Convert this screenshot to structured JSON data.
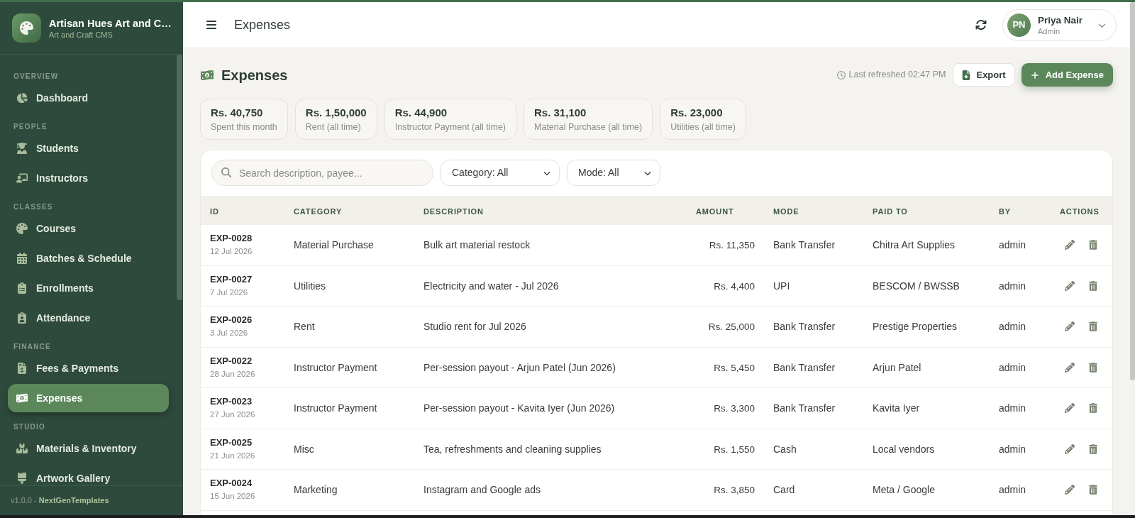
{
  "sidebar": {
    "brand": {
      "title": "Artisan Hues Art and C…",
      "subtitle": "Art and Craft CMS"
    },
    "sections": [
      {
        "heading": "OVERVIEW",
        "items": [
          {
            "label": "Dashboard",
            "selected": false
          }
        ]
      },
      {
        "heading": "PEOPLE",
        "items": [
          {
            "label": "Students",
            "selected": false
          },
          {
            "label": "Instructors",
            "selected": false
          }
        ]
      },
      {
        "heading": "CLASSES",
        "items": [
          {
            "label": "Courses",
            "selected": false
          },
          {
            "label": "Batches & Schedule",
            "selected": false
          },
          {
            "label": "Enrollments",
            "selected": false
          },
          {
            "label": "Attendance",
            "selected": false
          }
        ]
      },
      {
        "heading": "FINANCE",
        "items": [
          {
            "label": "Fees & Payments",
            "selected": false
          },
          {
            "label": "Expenses",
            "selected": true
          }
        ]
      },
      {
        "heading": "STUDIO",
        "items": [
          {
            "label": "Materials & Inventory",
            "selected": false
          },
          {
            "label": "Artwork Gallery",
            "selected": false
          }
        ]
      }
    ],
    "footer": "v1.0.0 - **NextGenTemplates**"
  },
  "header": {
    "title": "Expenses",
    "user": {
      "initials": "PN",
      "name": "Priya Nair",
      "role": "Admin"
    }
  },
  "page": {
    "title": "Expenses",
    "last_refreshed": "Last refreshed 02:47 PM",
    "actions": [
      {
        "label": "Export",
        "kind": "secondary"
      },
      {
        "label": "Add Expense",
        "kind": "primary"
      }
    ]
  },
  "stats": [
    {
      "value": "Rs. 40,750",
      "label": "Spent this month"
    },
    {
      "value": "Rs. 1,50,000",
      "label": "Rent (all time)"
    },
    {
      "value": "Rs. 44,900",
      "label": "Instructor Payment (all time)"
    },
    {
      "value": "Rs. 31,100",
      "label": "Material Purchase (all time)"
    },
    {
      "value": "Rs. 23,000",
      "label": "Utilities (all time)"
    }
  ],
  "filters": {
    "search": {
      "placeholder": "Search description, payee..."
    },
    "selects": [
      {
        "value": "Category: All"
      },
      {
        "value": "Mode: All"
      }
    ]
  },
  "table": {
    "columns": [
      "ID",
      "CATEGORY",
      "DESCRIPTION",
      "AMOUNT",
      "MODE",
      "PAID TO",
      "BY",
      "ACTIONS"
    ],
    "rows": [
      {
        "id": "EXP-0028",
        "date": "12 Jul 2026",
        "category": "Material Purchase",
        "description": "Bulk art material restock",
        "amount": "Rs. 11,350",
        "mode": "Bank Transfer",
        "paid_to": "Chitra Art Supplies",
        "by": "admin"
      },
      {
        "id": "EXP-0027",
        "date": "7 Jul 2026",
        "category": "Utilities",
        "description": "Electricity and water - Jul 2026",
        "amount": "Rs. 4,400",
        "mode": "UPI",
        "paid_to": "BESCOM / BWSSB",
        "by": "admin"
      },
      {
        "id": "EXP-0026",
        "date": "3 Jul 2026",
        "category": "Rent",
        "description": "Studio rent for Jul 2026",
        "amount": "Rs. 25,000",
        "mode": "Bank Transfer",
        "paid_to": "Prestige Properties",
        "by": "admin"
      },
      {
        "id": "EXP-0022",
        "date": "28 Jun 2026",
        "category": "Instructor Payment",
        "description": "Per-session payout - Arjun Patel (Jun 2026)",
        "amount": "Rs. 5,450",
        "mode": "Bank Transfer",
        "paid_to": "Arjun Patel",
        "by": "admin"
      },
      {
        "id": "EXP-0023",
        "date": "27 Jun 2026",
        "category": "Instructor Payment",
        "description": "Per-session payout - Kavita Iyer (Jun 2026)",
        "amount": "Rs. 3,300",
        "mode": "Bank Transfer",
        "paid_to": "Kavita Iyer",
        "by": "admin"
      },
      {
        "id": "EXP-0025",
        "date": "21 Jun 2026",
        "category": "Misc",
        "description": "Tea, refreshments and cleaning supplies",
        "amount": "Rs. 1,550",
        "mode": "Cash",
        "paid_to": "Local vendors",
        "by": "admin"
      },
      {
        "id": "EXP-0024",
        "date": "15 Jun 2026",
        "category": "Marketing",
        "description": "Instagram and Google ads",
        "amount": "Rs. 3,850",
        "mode": "Card",
        "paid_to": "Meta / Google",
        "by": "admin"
      }
    ]
  }
}
